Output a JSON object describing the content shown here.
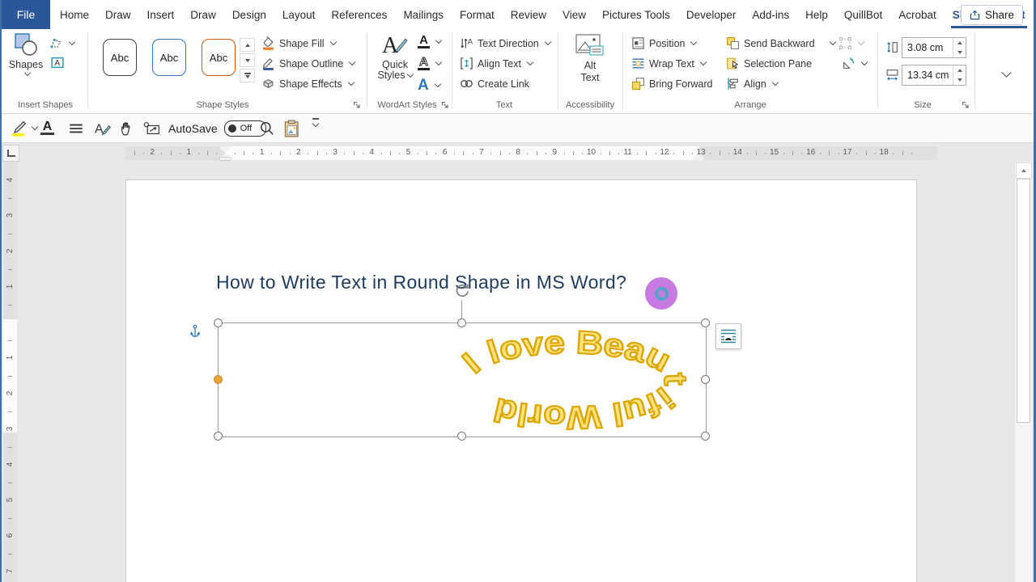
{
  "colors": {
    "accent": "#2B579A",
    "click_highlight": "#C77BE2",
    "title_color": "#1E3A5F",
    "wordart_fill": "#FFE380",
    "wordart_stroke": "#DCA702",
    "style_borders": [
      "#3F3F3F",
      "#2E75B6",
      "#C55A11"
    ]
  },
  "menu": {
    "file_label": "File",
    "items": [
      "Home",
      "Draw",
      "Insert",
      "Draw",
      "Design",
      "Layout",
      "References",
      "Mailings",
      "Format",
      "Review",
      "View",
      "Pictures Tools",
      "Developer",
      "Add-ins",
      "Help",
      "QuillBot",
      "Acrobat"
    ],
    "active_tab": "Shape Format",
    "share_label": "Share"
  },
  "ribbon": {
    "insert_shapes": {
      "shapes_label": "Shapes",
      "group_label": "Insert Shapes"
    },
    "shape_styles": {
      "style_label": "Abc",
      "fill_label": "Shape Fill",
      "outline_label": "Shape Outline",
      "effects_label": "Shape Effects",
      "group_label": "Shape Styles"
    },
    "wordart_styles": {
      "quick_label": "Quick",
      "styles_label": "Styles",
      "group_label": "WordArt Styles"
    },
    "text_group": {
      "direction_label": "Text Direction",
      "align_label": "Align Text",
      "link_label": "Create Link",
      "group_label": "Text"
    },
    "accessibility": {
      "alt_text_label": "Alt Text",
      "group_label": "Accessibility"
    },
    "arrange": {
      "position_label": "Position",
      "wrap_label": "Wrap Text",
      "bring_forward_label": "Bring Forward",
      "send_backward_label": "Send Backward",
      "selection_pane_label": "Selection Pane",
      "align_label": "Align",
      "group_label": "Arrange"
    },
    "size": {
      "height_value": "3.08 cm",
      "width_value": "13.34 cm",
      "group_label": "Size"
    }
  },
  "quick_toolbar": {
    "autosave_label": "AutoSave",
    "autosave_state": "Off"
  },
  "ruler": {
    "h_before": [
      2,
      1
    ],
    "h_after": [
      1,
      2,
      3,
      4,
      5,
      6,
      7,
      8,
      9,
      10,
      11,
      12,
      13,
      14,
      15,
      16,
      17,
      18
    ],
    "v_before": [
      4,
      3,
      2,
      1
    ],
    "v_after": [
      1,
      2,
      3,
      4,
      5,
      6,
      7
    ]
  },
  "document": {
    "title": "How to Write Text in Round Shape in MS Word?",
    "wordart_text": "I love Beautiful World"
  }
}
